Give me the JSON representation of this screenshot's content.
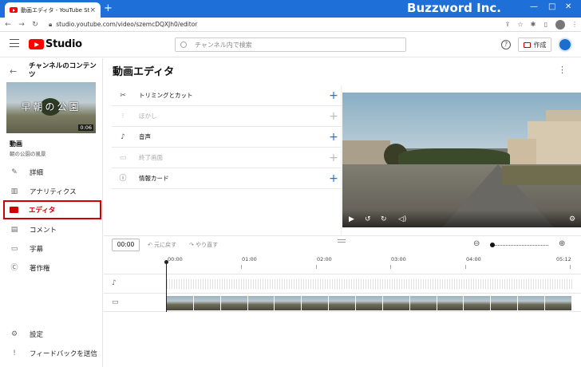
{
  "browser": {
    "tab_title": "動画エディタ - YouTube Studio",
    "tab_close": "×",
    "new_tab": "+",
    "brand_overlay": "Buzzword Inc.",
    "url": "studio.youtube.com/video/szemcDQXJh0/editor",
    "profile_initials": "",
    "win_min": "—",
    "win_max": "□",
    "win_close": "✕"
  },
  "header": {
    "logo_text": "Studio",
    "search_placeholder": "チャンネル内で検索",
    "create_label": "作成",
    "help_glyph": "?"
  },
  "sidebar": {
    "back_glyph": "←",
    "channel_title": "チャンネルのコンテンツ",
    "thumbnail_text": "早朝の公園",
    "thumbnail_duration": "0:06",
    "video_label": "動画",
    "video_name": "朝の公園の風景",
    "items": [
      {
        "label": "詳細",
        "icon": "pencil-icon"
      },
      {
        "label": "アナリティクス",
        "icon": "analytics-icon"
      },
      {
        "label": "エディタ",
        "icon": "clapper-icon",
        "active": true
      },
      {
        "label": "コメント",
        "icon": "comment-icon"
      },
      {
        "label": "字幕",
        "icon": "subtitles-icon"
      },
      {
        "label": "著作権",
        "icon": "copyright-icon"
      }
    ],
    "footer_items": [
      {
        "label": "設定",
        "icon": "gear-icon"
      },
      {
        "label": "フィードバックを送信",
        "icon": "feedback-icon"
      }
    ]
  },
  "main": {
    "page_title": "動画エディタ",
    "tools": [
      {
        "label": "トリミングとカット",
        "icon": "scissors-icon",
        "enabled": true
      },
      {
        "label": "ぼかし",
        "icon": "blur-icon",
        "enabled": false
      },
      {
        "label": "音声",
        "icon": "music-icon",
        "enabled": true
      },
      {
        "label": "終了画面",
        "icon": "endscreen-icon",
        "enabled": false
      },
      {
        "label": "情報カード",
        "icon": "info-icon",
        "enabled": true
      }
    ],
    "timecode": "00:00",
    "undo_label": "元に戻す",
    "redo_label": "やり直す",
    "ruler_ticks": [
      "00:00",
      "01:00",
      "02:00",
      "03:00",
      "04:00",
      "05:12"
    ]
  }
}
